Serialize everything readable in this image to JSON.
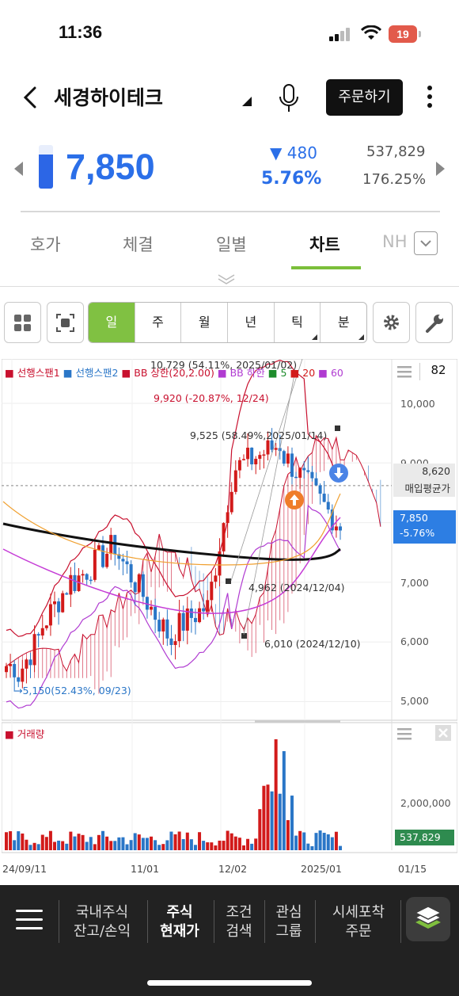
{
  "status": {
    "time": "11:36",
    "battery": "19"
  },
  "header": {
    "stock_name": "세경하이테크",
    "order_label": "주문하기"
  },
  "quote": {
    "price": "7,850",
    "change": "▼ 480",
    "change_pct": "5.76%",
    "volume": "537,829",
    "volume_pct": "176.25%",
    "level_fraction": 0.78,
    "price_color": "#2b6fe8"
  },
  "tabs": [
    "호가",
    "체결",
    "일별",
    "차트",
    "NH"
  ],
  "active_tab": "차트",
  "toolbar": {
    "periods": [
      "일",
      "주",
      "월",
      "년",
      "틱",
      "분"
    ],
    "active_period": "일"
  },
  "chart": {
    "legend": [
      {
        "label": "■ 선행스팬1",
        "color": "#c8102e"
      },
      {
        "label": "■ 선행스팬2",
        "color": "#2a76c7"
      },
      {
        "label": "■ BB 상한(20,2.00)",
        "color": "#c8102e"
      },
      {
        "label": "■ BB 하한",
        "color": "#b03bd1"
      },
      {
        "label": "■ 5",
        "color": "#1e8c2c"
      },
      {
        "label": "■ 20",
        "color": "#d21a1a"
      },
      {
        "label": "■ 60",
        "color": "#b03bd1"
      }
    ],
    "panel_count": "82",
    "annotations": {
      "high_1": "10,729 (54.11%, 2025/01/02)",
      "high_2": "9,920 (-20.87%, 12/24)",
      "high_3": "9,525 (58.49%,2025/01/14)",
      "low_1": "4,962 (2024/12/04)",
      "low_2": "6,010 (2024/12/10)",
      "low_3": "→5,150(52.43%, 09/23)"
    },
    "avg_price": "8,620",
    "avg_price_label": "매입평균가",
    "current_price": "7,850",
    "current_pct": "-5.76%",
    "volume_title": "■ 거래량",
    "volume_tag": "537,829",
    "x_labels": [
      "24/09/11",
      "11/01",
      "12/02",
      "2025/01",
      "01/15"
    ]
  },
  "chart_data": {
    "type": "candlestick",
    "y_ticks": [
      10000,
      9000,
      8000,
      7000,
      6000,
      5000
    ],
    "volume_ticks": [
      2000000
    ],
    "markers": {
      "avg_price": 8620,
      "last_price": 7850,
      "last_volume": 537829
    },
    "highs_lows": [
      {
        "value": 10729,
        "date": "2025/01/02"
      },
      {
        "value": 9920,
        "date": "12/24"
      },
      {
        "value": 9525,
        "date": "2025/01/14"
      },
      {
        "value": 4962,
        "date": "2024/12/04"
      },
      {
        "value": 6010,
        "date": "2024/12/10"
      },
      {
        "value": 5150,
        "date": "09/23"
      }
    ]
  },
  "bottom_nav": [
    {
      "l1": "국내주식",
      "l2": "잔고/손익"
    },
    {
      "l1": "주식",
      "l2": "현재가"
    },
    {
      "l1": "조건",
      "l2": "검색"
    },
    {
      "l1": "관심",
      "l2": "그룹"
    },
    {
      "l1": "시세포착",
      "l2": "주문"
    }
  ]
}
